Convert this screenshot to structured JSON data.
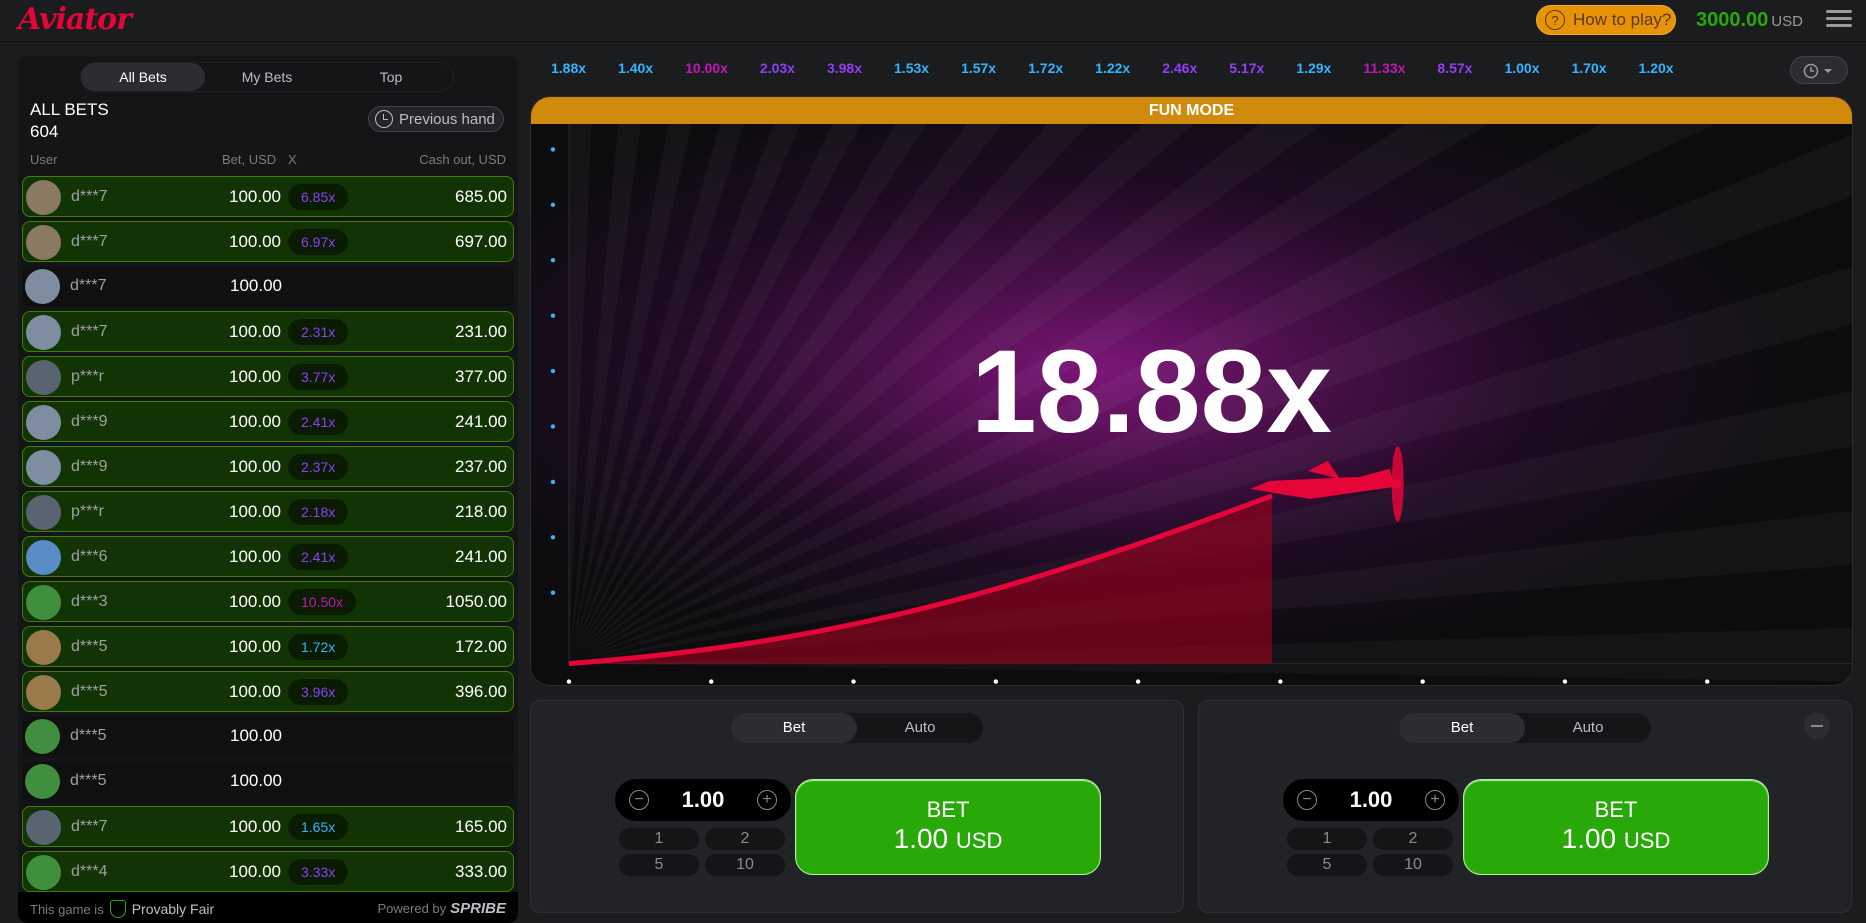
{
  "app": {
    "logo": "Aviator",
    "how_to_play": "How to play?",
    "balance": "3000.00",
    "currency": "USD"
  },
  "bets_panel": {
    "tabs": [
      "All Bets",
      "My Bets",
      "Top"
    ],
    "active_tab": "All Bets",
    "title": "ALL BETS",
    "count": "604",
    "previous_hand": "Previous hand",
    "columns": {
      "user": "User",
      "bet": "Bet, USD",
      "x": "X",
      "cashout": "Cash out, USD"
    },
    "rows": [
      {
        "user": "d***7",
        "bet": "100.00",
        "mult": "6.85x",
        "cashout": "685.00",
        "win": true,
        "mult_color": "#913ef8",
        "avatar": "hand-avatar"
      },
      {
        "user": "d***7",
        "bet": "100.00",
        "mult": "6.97x",
        "cashout": "697.00",
        "win": true,
        "mult_color": "#913ef8",
        "avatar": "hand-avatar"
      },
      {
        "user": "d***7",
        "bet": "100.00",
        "mult": "",
        "cashout": "",
        "win": false,
        "mult_color": "",
        "avatar": "coin-avatar"
      },
      {
        "user": "d***7",
        "bet": "100.00",
        "mult": "2.31x",
        "cashout": "231.00",
        "win": true,
        "mult_color": "#913ef8",
        "avatar": "coin-avatar"
      },
      {
        "user": "p***r",
        "bet": "100.00",
        "mult": "3.77x",
        "cashout": "377.00",
        "win": true,
        "mult_color": "#913ef8",
        "avatar": "jet-avatar"
      },
      {
        "user": "d***9",
        "bet": "100.00",
        "mult": "2.41x",
        "cashout": "241.00",
        "win": true,
        "mult_color": "#913ef8",
        "avatar": "coin-avatar"
      },
      {
        "user": "d***9",
        "bet": "100.00",
        "mult": "2.37x",
        "cashout": "237.00",
        "win": true,
        "mult_color": "#913ef8",
        "avatar": "coin-avatar"
      },
      {
        "user": "p***r",
        "bet": "100.00",
        "mult": "2.18x",
        "cashout": "218.00",
        "win": true,
        "mult_color": "#913ef8",
        "avatar": "jet-avatar"
      },
      {
        "user": "d***6",
        "bet": "100.00",
        "mult": "2.41x",
        "cashout": "241.00",
        "win": true,
        "mult_color": "#913ef8",
        "avatar": "plane-avatar"
      },
      {
        "user": "d***3",
        "bet": "100.00",
        "mult": "10.50x",
        "cashout": "1050.00",
        "win": true,
        "mult_color": "#c017b4",
        "avatar": "clover-avatar"
      },
      {
        "user": "d***5",
        "bet": "100.00",
        "mult": "1.72x",
        "cashout": "172.00",
        "win": true,
        "mult_color": "#34b4ff",
        "avatar": "lion-avatar"
      },
      {
        "user": "d***5",
        "bet": "100.00",
        "mult": "3.96x",
        "cashout": "396.00",
        "win": true,
        "mult_color": "#913ef8",
        "avatar": "lion-avatar"
      },
      {
        "user": "d***5",
        "bet": "100.00",
        "mult": "",
        "cashout": "",
        "win": false,
        "mult_color": "",
        "avatar": "clover-avatar"
      },
      {
        "user": "d***5",
        "bet": "100.00",
        "mult": "",
        "cashout": "",
        "win": false,
        "mult_color": "",
        "avatar": "clover-avatar"
      },
      {
        "user": "d***7",
        "bet": "100.00",
        "mult": "1.65x",
        "cashout": "165.00",
        "win": true,
        "mult_color": "#34b4ff",
        "avatar": "jet-avatar"
      },
      {
        "user": "d***4",
        "bet": "100.00",
        "mult": "3.33x",
        "cashout": "333.00",
        "win": true,
        "mult_color": "#913ef8",
        "avatar": "clover-avatar"
      }
    ],
    "footer": {
      "game_is": "This game is",
      "provably_fair": "Provably Fair",
      "powered_by": "Powered by",
      "brand": "SPRIBE"
    }
  },
  "history": [
    {
      "v": "1.88x",
      "c": "#34b4ff"
    },
    {
      "v": "1.40x",
      "c": "#34b4ff"
    },
    {
      "v": "10.00x",
      "c": "#c017b4"
    },
    {
      "v": "2.03x",
      "c": "#913ef8"
    },
    {
      "v": "3.98x",
      "c": "#913ef8"
    },
    {
      "v": "1.53x",
      "c": "#34b4ff"
    },
    {
      "v": "1.57x",
      "c": "#34b4ff"
    },
    {
      "v": "1.72x",
      "c": "#34b4ff"
    },
    {
      "v": "1.22x",
      "c": "#34b4ff"
    },
    {
      "v": "2.46x",
      "c": "#913ef8"
    },
    {
      "v": "5.17x",
      "c": "#913ef8"
    },
    {
      "v": "1.29x",
      "c": "#34b4ff"
    },
    {
      "v": "11.33x",
      "c": "#c017b4"
    },
    {
      "v": "8.57x",
      "c": "#913ef8"
    },
    {
      "v": "1.00x",
      "c": "#34b4ff"
    },
    {
      "v": "1.70x",
      "c": "#34b4ff"
    },
    {
      "v": "1.20x",
      "c": "#34b4ff"
    }
  ],
  "game": {
    "mode_banner": "FUN MODE",
    "multiplier": "18.88x"
  },
  "bet_panels": [
    {
      "tabs": [
        "Bet",
        "Auto"
      ],
      "amount": "1.00",
      "quick": [
        "1",
        "2",
        "5",
        "10"
      ],
      "bet_label": "BET",
      "bet_amount": "1.00",
      "bet_currency": "USD"
    },
    {
      "tabs": [
        "Bet",
        "Auto"
      ],
      "amount": "1.00",
      "quick": [
        "1",
        "2",
        "5",
        "10"
      ],
      "bet_label": "BET",
      "bet_amount": "1.00",
      "bet_currency": "USD"
    }
  ]
}
